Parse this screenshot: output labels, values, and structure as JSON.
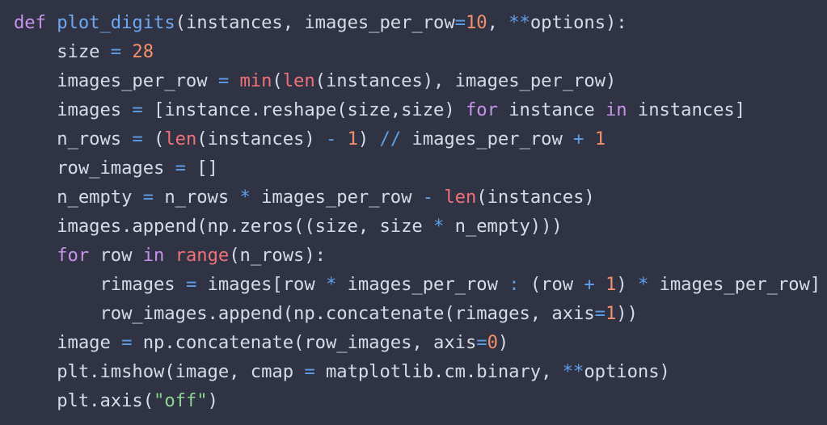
{
  "editor": {
    "language": "python",
    "background_color": "#2f3343",
    "default_text_color": "#d6dbe8",
    "theme_colors": {
      "keyword": "#c792ea",
      "function_name": "#6fa8f0",
      "builtin": "#f07178",
      "operator": "#5f9fe8",
      "number": "#f2906b",
      "string": "#8fd492",
      "identifier": "#d6dbe8"
    },
    "lines": [
      {
        "id": "line-1",
        "indent": "",
        "text": "def plot_digits(instances, images_per_row=10, **options):",
        "tokens": [
          {
            "t": "def",
            "c": "t-kw"
          },
          {
            "t": " ",
            "c": "t-id"
          },
          {
            "t": "plot_digits",
            "c": "t-fn"
          },
          {
            "t": "(instances, images_per_row",
            "c": "t-id"
          },
          {
            "t": "=",
            "c": "t-op"
          },
          {
            "t": "10",
            "c": "t-num"
          },
          {
            "t": ", ",
            "c": "t-id"
          },
          {
            "t": "**",
            "c": "t-op"
          },
          {
            "t": "options):",
            "c": "t-id"
          }
        ]
      },
      {
        "id": "line-2",
        "indent": "    ",
        "text": "    size = 28",
        "tokens": [
          {
            "t": "    size ",
            "c": "t-id"
          },
          {
            "t": "=",
            "c": "t-op"
          },
          {
            "t": " ",
            "c": "t-id"
          },
          {
            "t": "28",
            "c": "t-num"
          }
        ]
      },
      {
        "id": "line-3",
        "indent": "    ",
        "text": "    images_per_row = min(len(instances), images_per_row)",
        "tokens": [
          {
            "t": "    images_per_row ",
            "c": "t-id"
          },
          {
            "t": "=",
            "c": "t-op"
          },
          {
            "t": " ",
            "c": "t-id"
          },
          {
            "t": "min",
            "c": "t-bi"
          },
          {
            "t": "(",
            "c": "t-id"
          },
          {
            "t": "len",
            "c": "t-bi"
          },
          {
            "t": "(instances), images_per_row)",
            "c": "t-id"
          }
        ]
      },
      {
        "id": "line-4",
        "indent": "    ",
        "text": "    images = [instance.reshape(size,size) for instance in instances]",
        "tokens": [
          {
            "t": "    images ",
            "c": "t-id"
          },
          {
            "t": "=",
            "c": "t-op"
          },
          {
            "t": " [instance.reshape(size,size) ",
            "c": "t-id"
          },
          {
            "t": "for",
            "c": "t-kw"
          },
          {
            "t": " instance ",
            "c": "t-id"
          },
          {
            "t": "in",
            "c": "t-kw"
          },
          {
            "t": " instances]",
            "c": "t-id"
          }
        ]
      },
      {
        "id": "line-5",
        "indent": "    ",
        "text": "    n_rows = (len(instances) - 1) // images_per_row + 1",
        "tokens": [
          {
            "t": "    n_rows ",
            "c": "t-id"
          },
          {
            "t": "=",
            "c": "t-op"
          },
          {
            "t": " (",
            "c": "t-id"
          },
          {
            "t": "len",
            "c": "t-bi"
          },
          {
            "t": "(instances) ",
            "c": "t-id"
          },
          {
            "t": "-",
            "c": "t-op"
          },
          {
            "t": " ",
            "c": "t-id"
          },
          {
            "t": "1",
            "c": "t-num"
          },
          {
            "t": ") ",
            "c": "t-id"
          },
          {
            "t": "//",
            "c": "t-op"
          },
          {
            "t": " images_per_row ",
            "c": "t-id"
          },
          {
            "t": "+",
            "c": "t-op"
          },
          {
            "t": " ",
            "c": "t-id"
          },
          {
            "t": "1",
            "c": "t-num"
          }
        ]
      },
      {
        "id": "line-6",
        "indent": "    ",
        "text": "    row_images = []",
        "tokens": [
          {
            "t": "    row_images ",
            "c": "t-id"
          },
          {
            "t": "=",
            "c": "t-op"
          },
          {
            "t": " []",
            "c": "t-id"
          }
        ]
      },
      {
        "id": "line-7",
        "indent": "    ",
        "text": "    n_empty = n_rows * images_per_row - len(instances)",
        "tokens": [
          {
            "t": "    n_empty ",
            "c": "t-id"
          },
          {
            "t": "=",
            "c": "t-op"
          },
          {
            "t": " n_rows ",
            "c": "t-id"
          },
          {
            "t": "*",
            "c": "t-op"
          },
          {
            "t": " images_per_row ",
            "c": "t-id"
          },
          {
            "t": "-",
            "c": "t-op"
          },
          {
            "t": " ",
            "c": "t-id"
          },
          {
            "t": "len",
            "c": "t-bi"
          },
          {
            "t": "(instances)",
            "c": "t-id"
          }
        ]
      },
      {
        "id": "line-8",
        "indent": "    ",
        "text": "    images.append(np.zeros((size, size * n_empty)))",
        "tokens": [
          {
            "t": "    images.append(np.zeros((size, size ",
            "c": "t-id"
          },
          {
            "t": "*",
            "c": "t-op"
          },
          {
            "t": " n_empty)))",
            "c": "t-id"
          }
        ]
      },
      {
        "id": "line-9",
        "indent": "    ",
        "text": "    for row in range(n_rows):",
        "tokens": [
          {
            "t": "    ",
            "c": "t-id"
          },
          {
            "t": "for",
            "c": "t-kw"
          },
          {
            "t": " row ",
            "c": "t-id"
          },
          {
            "t": "in",
            "c": "t-kw"
          },
          {
            "t": " ",
            "c": "t-id"
          },
          {
            "t": "range",
            "c": "t-bi"
          },
          {
            "t": "(n_rows):",
            "c": "t-id"
          }
        ]
      },
      {
        "id": "line-10",
        "indent": "        ",
        "text": "        rimages = images[row * images_per_row : (row + 1) * images_per_row]",
        "tokens": [
          {
            "t": "        rimages ",
            "c": "t-id"
          },
          {
            "t": "=",
            "c": "t-op"
          },
          {
            "t": " images[row ",
            "c": "t-id"
          },
          {
            "t": "*",
            "c": "t-op"
          },
          {
            "t": " images_per_row ",
            "c": "t-id"
          },
          {
            "t": ":",
            "c": "t-op"
          },
          {
            "t": " (row ",
            "c": "t-id"
          },
          {
            "t": "+",
            "c": "t-op"
          },
          {
            "t": " ",
            "c": "t-id"
          },
          {
            "t": "1",
            "c": "t-num"
          },
          {
            "t": ") ",
            "c": "t-id"
          },
          {
            "t": "*",
            "c": "t-op"
          },
          {
            "t": " images_per_row]",
            "c": "t-id"
          }
        ]
      },
      {
        "id": "line-11",
        "indent": "        ",
        "text": "        row_images.append(np.concatenate(rimages, axis=1))",
        "tokens": [
          {
            "t": "        row_images.append(np.concatenate(rimages, axis",
            "c": "t-id"
          },
          {
            "t": "=",
            "c": "t-op"
          },
          {
            "t": "1",
            "c": "t-num"
          },
          {
            "t": "))",
            "c": "t-id"
          }
        ]
      },
      {
        "id": "line-12",
        "indent": "    ",
        "text": "    image = np.concatenate(row_images, axis=0)",
        "tokens": [
          {
            "t": "    image ",
            "c": "t-id"
          },
          {
            "t": "=",
            "c": "t-op"
          },
          {
            "t": " np.concatenate(row_images, axis",
            "c": "t-id"
          },
          {
            "t": "=",
            "c": "t-op"
          },
          {
            "t": "0",
            "c": "t-num"
          },
          {
            "t": ")",
            "c": "t-id"
          }
        ]
      },
      {
        "id": "line-13",
        "indent": "    ",
        "text": "    plt.imshow(image, cmap = matplotlib.cm.binary, **options)",
        "tokens": [
          {
            "t": "    plt.imshow(image, cmap ",
            "c": "t-id"
          },
          {
            "t": "=",
            "c": "t-op"
          },
          {
            "t": " matplotlib.cm.binary, ",
            "c": "t-id"
          },
          {
            "t": "**",
            "c": "t-op"
          },
          {
            "t": "options)",
            "c": "t-id"
          }
        ]
      },
      {
        "id": "line-14",
        "indent": "    ",
        "text": "    plt.axis(\"off\")",
        "tokens": [
          {
            "t": "    plt.axis(",
            "c": "t-id"
          },
          {
            "t": "\"off\"",
            "c": "t-str"
          },
          {
            "t": ")",
            "c": "t-id"
          }
        ]
      }
    ]
  }
}
